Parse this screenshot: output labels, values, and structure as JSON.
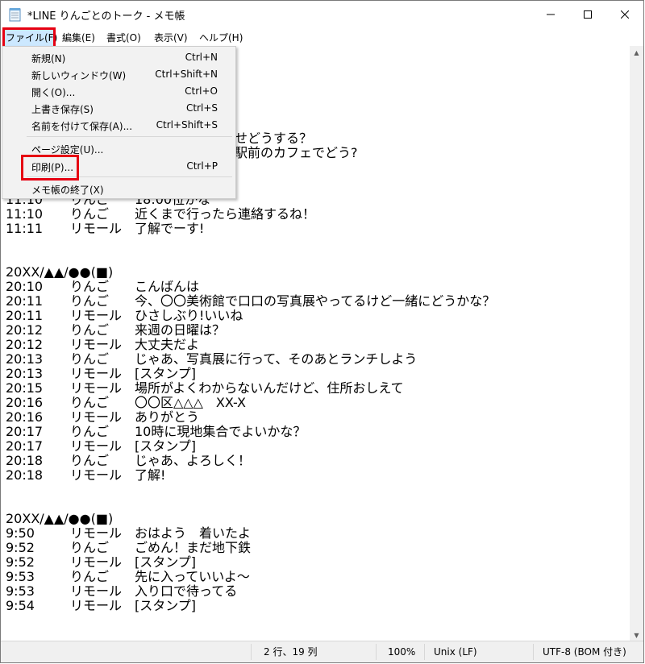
{
  "window": {
    "title": "*LINE りんごとのトーク - メモ帳"
  },
  "menu": {
    "file": "ファイル(F)",
    "edit": "編集(E)",
    "format": "書式(O)",
    "view": "表示(V)",
    "help": "ヘルプ(H)"
  },
  "file_menu": {
    "new": {
      "label": "新規(N)",
      "shortcut": "Ctrl+N"
    },
    "new_window": {
      "label": "新しいウィンドウ(W)",
      "shortcut": "Ctrl+Shift+N"
    },
    "open": {
      "label": "開く(O)...",
      "shortcut": "Ctrl+O"
    },
    "save": {
      "label": "上書き保存(S)",
      "shortcut": "Ctrl+S"
    },
    "save_as": {
      "label": "名前を付けて保存(A)...",
      "shortcut": "Ctrl+Shift+S"
    },
    "page_setup": {
      "label": "ページ設定(U)..."
    },
    "print": {
      "label": "印刷(P)...",
      "shortcut": "Ctrl+P"
    },
    "exit": {
      "label": "メモ帳の終了(X)"
    }
  },
  "editor": {
    "visible_partial": {
      "line_a": "せどうする？",
      "line_b": "駅前のカフェでどう?",
      "line_c_time": "11:10",
      "line_c_name": "りんご",
      "line_c_msg": "18:00位かな"
    },
    "lines": [
      {
        "time": "11:10",
        "name": "りんご",
        "msg": "近くまで行ったら連絡するね！"
      },
      {
        "time": "11:11",
        "name": "リモール",
        "msg": "了解でーす!"
      },
      {
        "time": "",
        "name": "",
        "msg": ""
      },
      {
        "time": "",
        "name": "",
        "msg": ""
      },
      {
        "time": "20XX/▲▲/●●(■)",
        "name": "",
        "msg": ""
      },
      {
        "time": "20:10",
        "name": "りんご",
        "msg": "こんばんは"
      },
      {
        "time": "20:11",
        "name": "りんご",
        "msg": "今、〇〇美術館で口口の写真展やってるけど一緒にどうかな？"
      },
      {
        "time": "20:11",
        "name": "リモール",
        "msg": "ひさしぶり!いいね"
      },
      {
        "time": "20:12",
        "name": "りんご",
        "msg": "来週の日曜は？"
      },
      {
        "time": "20:12",
        "name": "リモール",
        "msg": "大丈夫だよ"
      },
      {
        "time": "20:13",
        "name": "りんご",
        "msg": "じゃあ、写真展に行って、そのあとランチしよう"
      },
      {
        "time": "20:13",
        "name": "リモール",
        "msg": "[スタンプ]"
      },
      {
        "time": "20:15",
        "name": "リモール",
        "msg": "場所がよくわからないんだけど、住所おしえて"
      },
      {
        "time": "20:16",
        "name": "りんご",
        "msg": "〇〇区△△△　XX-X"
      },
      {
        "time": "20:16",
        "name": "リモール",
        "msg": "ありがとう"
      },
      {
        "time": "20:17",
        "name": "りんご",
        "msg": "10時に現地集合でよいかな？"
      },
      {
        "time": "20:17",
        "name": "リモール",
        "msg": "[スタンプ]"
      },
      {
        "time": "20:18",
        "name": "りんご",
        "msg": "じゃあ、よろしく！"
      },
      {
        "time": "20:18",
        "name": "リモール",
        "msg": "了解!"
      },
      {
        "time": "",
        "name": "",
        "msg": ""
      },
      {
        "time": "",
        "name": "",
        "msg": ""
      },
      {
        "time": "20XX/▲▲/●●(■)",
        "name": "",
        "msg": ""
      },
      {
        "time": "9:50",
        "name": "リモール",
        "msg": "おはよう　着いたよ"
      },
      {
        "time": "9:52",
        "name": "りんご",
        "msg": "ごめん！まだ地下鉄"
      },
      {
        "time": "9:52",
        "name": "リモール",
        "msg": "[スタンプ]"
      },
      {
        "time": "9:53",
        "name": "りんご",
        "msg": "先に入っていいよ～"
      },
      {
        "time": "9:53",
        "name": "リモール",
        "msg": "入り口で待ってる"
      },
      {
        "time": "9:54",
        "name": "リモール",
        "msg": "[スタンプ]"
      }
    ]
  },
  "status": {
    "position": "2 行、19 列",
    "zoom": "100%",
    "line_ending": "Unix (LF)",
    "encoding": "UTF-8 (BOM 付き)"
  },
  "colors": {
    "highlight_border": "#e60012",
    "menu_active": "#cce8ff"
  }
}
